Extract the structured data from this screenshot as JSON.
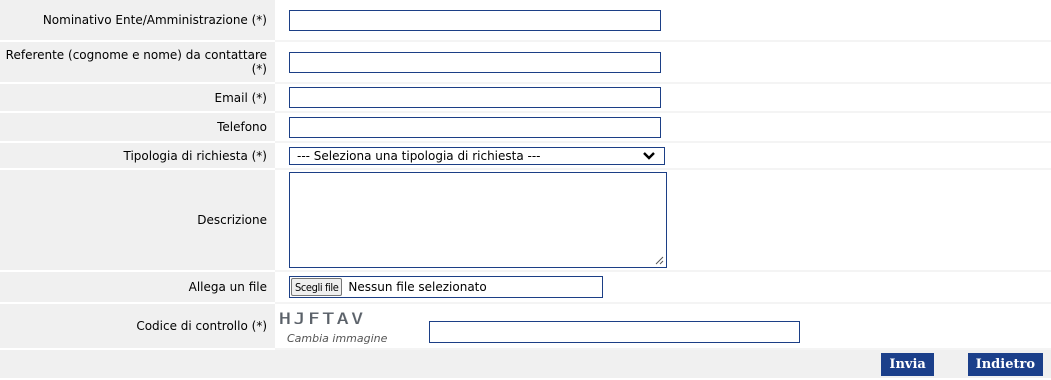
{
  "fields": {
    "ente_label": "Nominativo Ente/Amministrazione (*)",
    "referente_label": "Referente (cognome e nome) da contattare (*)",
    "email_label": "Email (*)",
    "telefono_label": "Telefono",
    "tipologia_label": "Tipologia di richiesta (*)",
    "tipologia_selected": "--- Seleziona una tipologia di richiesta ---",
    "descrizione_label": "Descrizione",
    "allega_label": "Allega un file",
    "file_button": "Scegli file",
    "file_status": "Nessun file selezionato",
    "codice_label": "Codice di controllo (*)",
    "captcha_text": "HJFTAV",
    "captcha_link": "Cambia immagine"
  },
  "actions": {
    "invia": "Invia",
    "indietro": "Indietro"
  },
  "colors": {
    "border": "#1c3f86",
    "button_bg": "#1b3f8a",
    "label_bg": "#f0f0f0"
  }
}
